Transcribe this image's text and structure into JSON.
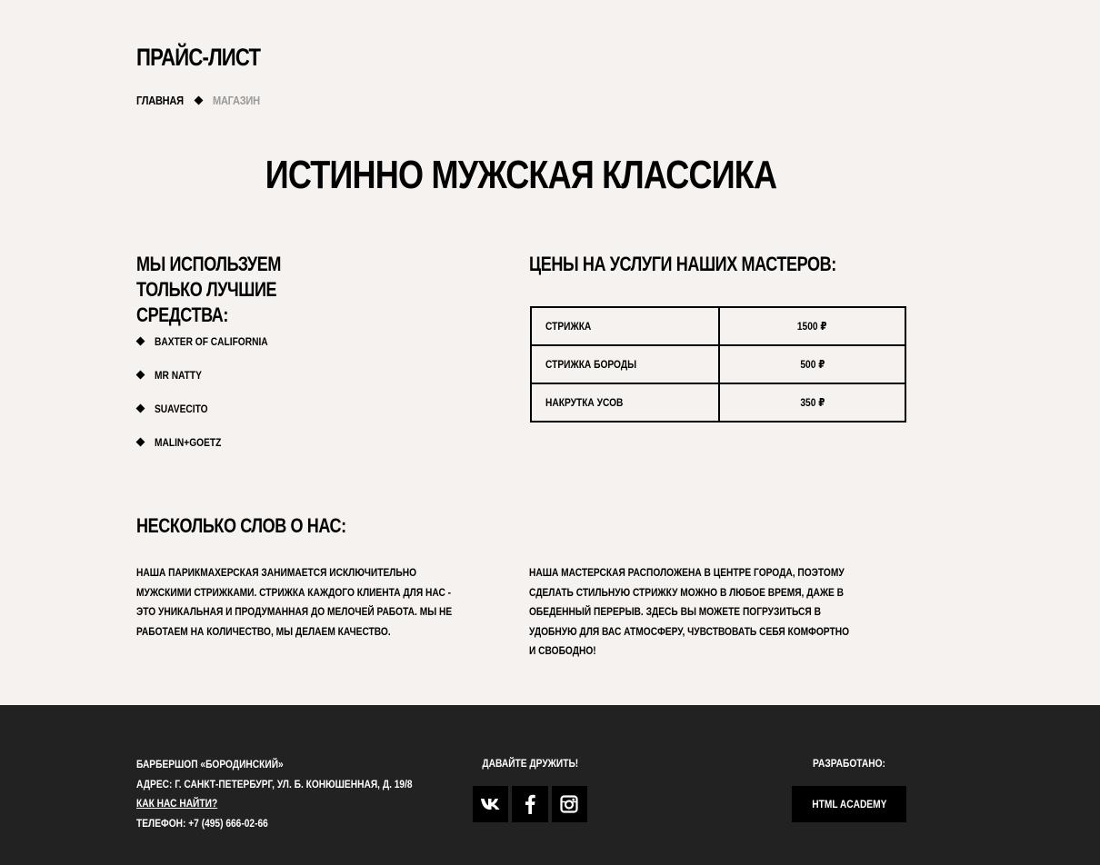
{
  "page": {
    "title": "ПРАЙС-ЛИСТ",
    "breadcrumb": {
      "home": "ГЛАВНАЯ",
      "current": "МАГАЗИН"
    }
  },
  "main": {
    "heading": "ИСТИННО МУЖСКАЯ КЛАССИКА",
    "products": {
      "heading": "МЫ ИСПОЛЬЗУЕМ ТОЛЬКО ЛУЧШИЕ СРЕДСТВА:",
      "items": [
        "BAXTER OF CALIFORNIA",
        "MR NATTY",
        "SUAVECITO",
        "MALIN+GOETZ"
      ]
    },
    "prices": {
      "heading": "ЦЕНЫ НА УСЛУГИ НАШИХ МАСТЕРОВ:",
      "rows": [
        {
          "service": "СТРИЖКА",
          "price": "1500 ₽"
        },
        {
          "service": "СТРИЖКА БОРОДЫ",
          "price": "500 ₽"
        },
        {
          "service": "НАКРУТКА УСОВ",
          "price": "350 ₽"
        }
      ]
    },
    "about": {
      "heading": "НЕСКОЛЬКО СЛОВ О НАС:",
      "left": "НАША ПАРИКМАХЕРСКАЯ ЗАНИМАЕТСЯ ИСКЛЮЧИТЕЛЬНО МУЖСКИМИ СТРИЖКАМИ. СТРИЖКА КАЖДОГО КЛИЕНТА ДЛЯ НАС - ЭТО УНИКАЛЬНАЯ И ПРОДУМАННАЯ ДО МЕЛОЧЕЙ РАБОТА. МЫ НЕ РАБОТАЕМ НА КОЛИЧЕСТВО, МЫ ДЕЛАЕМ КАЧЕСТВО.",
      "right": "НАША МАСТЕРСКАЯ РАСПОЛОЖЕНА В ЦЕНТРЕ ГОРОДА, ПОЭТОМУ СДЕЛАТЬ СТИЛЬНУЮ СТРИЖКУ МОЖНО В ЛЮБОЕ ВРЕМЯ, ДАЖЕ В ОБЕДЕННЫЙ ПЕРЕРЫВ. ЗДЕСЬ ВЫ МОЖЕТЕ ПОГРУЗИТЬСЯ В УДОБНУЮ ДЛЯ ВАС АТМОСФЕРУ, ЧУВСТВОВАТЬ СЕБЯ КОМФОРТНО И СВОБОДНО!"
    }
  },
  "footer": {
    "name": "БАРБЕРШОП «БОРОДИНСКИЙ»",
    "address": "АДРЕС: Г. САНКТ-ПЕТЕРБУРГ, УЛ. Б. КОНЮШЕННАЯ, Д. 19/8",
    "find_link": "КАК НАС НАЙТИ?",
    "phone": "ТЕЛЕФОН: +7 (495) 666-02-66",
    "social_title": "ДАВАЙТЕ ДРУЖИТЬ!",
    "social_icons": [
      "vk-icon",
      "facebook-icon",
      "instagram-icon"
    ],
    "dev_title": "РАЗРАБОТАНО:",
    "dev_link": "HTML ACADEMY"
  },
  "colors": {
    "background": "#f5f2ef",
    "footer": "#222222",
    "button": "#000000",
    "muted": "#9a9a9a"
  }
}
